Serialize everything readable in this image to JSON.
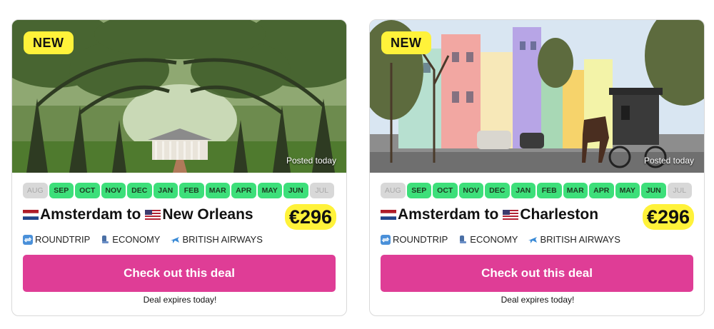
{
  "deals": [
    {
      "badge": "NEW",
      "posted": "Posted today",
      "months": [
        {
          "label": "AUG",
          "active": false
        },
        {
          "label": "SEP",
          "active": true
        },
        {
          "label": "OCT",
          "active": true
        },
        {
          "label": "NOV",
          "active": true
        },
        {
          "label": "DEC",
          "active": true
        },
        {
          "label": "JAN",
          "active": true
        },
        {
          "label": "FEB",
          "active": true
        },
        {
          "label": "MAR",
          "active": true
        },
        {
          "label": "APR",
          "active": true
        },
        {
          "label": "MAY",
          "active": true
        },
        {
          "label": "JUN",
          "active": true
        },
        {
          "label": "JUL",
          "active": false
        }
      ],
      "origin": "Amsterdam",
      "connector": "to",
      "destination": "New Orleans",
      "price": "€296",
      "trip_type": "ROUNDTRIP",
      "cabin": "ECONOMY",
      "airline": "BRITISH AIRWAYS",
      "cta": "Check out this deal",
      "expires": "Deal expires today!",
      "image": "oak-alley-plantation-photo"
    },
    {
      "badge": "NEW",
      "posted": "Posted today",
      "months": [
        {
          "label": "AUG",
          "active": false
        },
        {
          "label": "SEP",
          "active": true
        },
        {
          "label": "OCT",
          "active": true
        },
        {
          "label": "NOV",
          "active": true
        },
        {
          "label": "DEC",
          "active": true
        },
        {
          "label": "JAN",
          "active": true
        },
        {
          "label": "FEB",
          "active": true
        },
        {
          "label": "MAR",
          "active": true
        },
        {
          "label": "APR",
          "active": true
        },
        {
          "label": "MAY",
          "active": true
        },
        {
          "label": "JUN",
          "active": true
        },
        {
          "label": "JUL",
          "active": false
        }
      ],
      "origin": "Amsterdam",
      "connector": "to",
      "destination": "Charleston",
      "price": "€296",
      "trip_type": "ROUNDTRIP",
      "cabin": "ECONOMY",
      "airline": "BRITISH AIRWAYS",
      "cta": "Check out this deal",
      "expires": "Deal expires today!",
      "image": "rainbow-row-carriage-photo"
    }
  ],
  "colors": {
    "badge": "#fff23a",
    "month_active": "#3ddf7a",
    "month_inactive": "#d8d8d8",
    "cta": "#df3d96",
    "price_highlight": "#fff23a"
  }
}
